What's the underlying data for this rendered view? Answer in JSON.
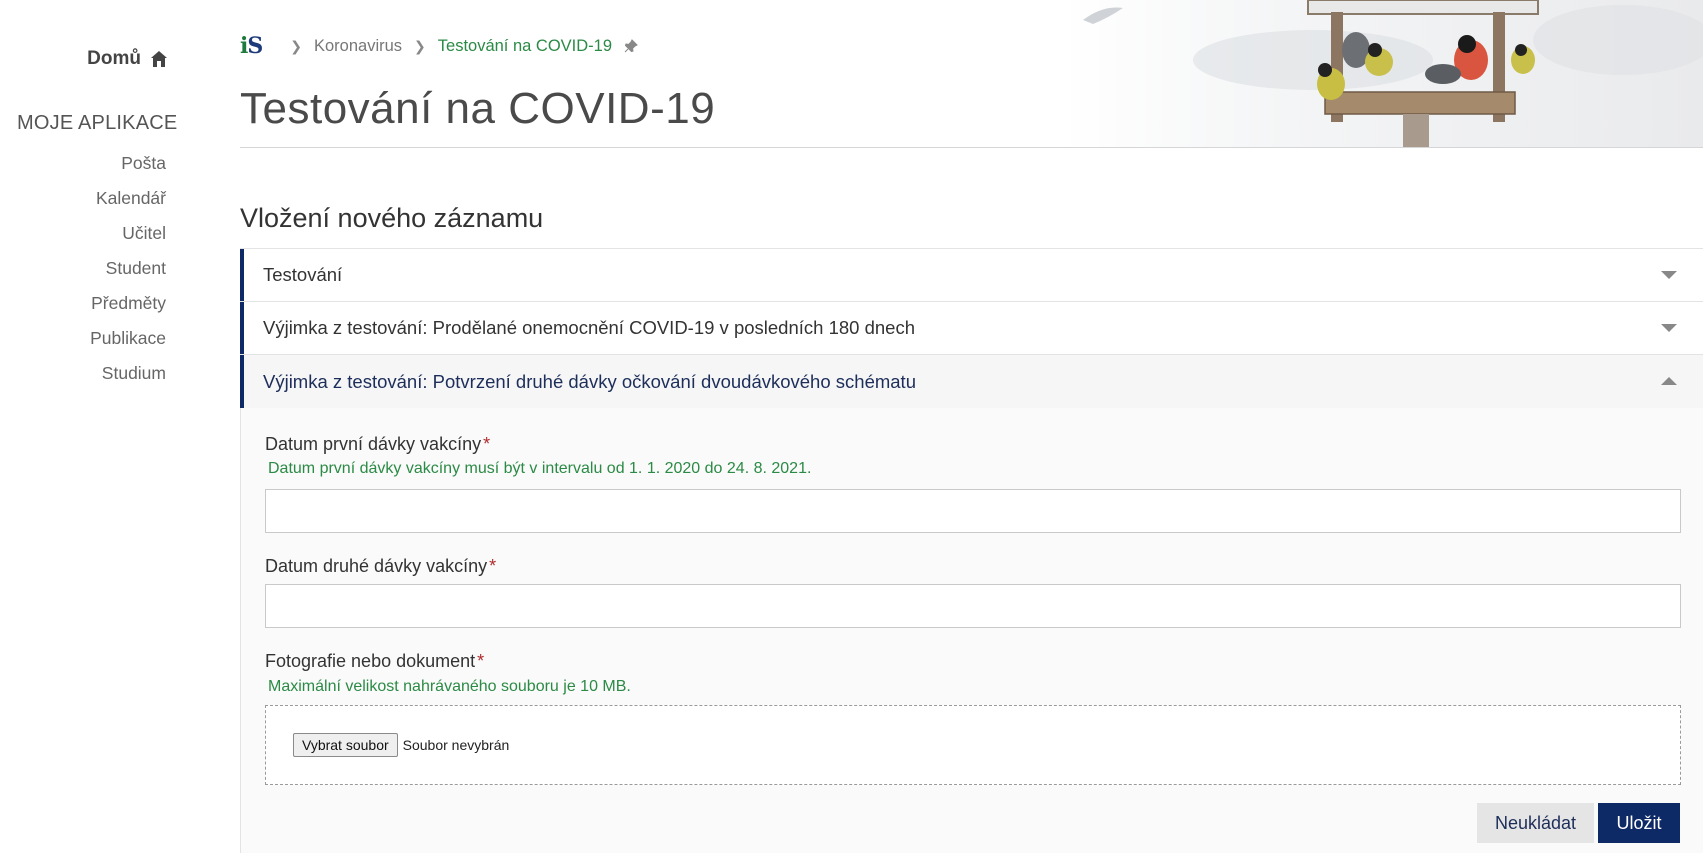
{
  "sidebar": {
    "home_label": "Domů",
    "apps_heading": "MOJE APLIKACE",
    "items": [
      {
        "label": "Pošta"
      },
      {
        "label": "Kalendář"
      },
      {
        "label": "Učitel"
      },
      {
        "label": "Student"
      },
      {
        "label": "Předměty"
      },
      {
        "label": "Publikace"
      },
      {
        "label": "Studium"
      }
    ]
  },
  "header": {
    "logo_i": "i",
    "logo_s": "S",
    "breadcrumb": [
      "Koronavirus",
      "Testování na COVID-19"
    ],
    "title": "Testování na COVID-19"
  },
  "main": {
    "section_title": "Vložení nového záznamu",
    "accordion": [
      {
        "label": "Testování",
        "open": false
      },
      {
        "label": "Výjimka z testování: Prodělané onemocnění COVID-19 v posledních 180 dnech",
        "open": false
      },
      {
        "label": "Výjimka z testování: Potvrzení druhé dávky očkování dvoudávkového schématu",
        "open": true
      }
    ],
    "form": {
      "first_dose_label": "Datum první dávky vakcíny",
      "required_mark": "*",
      "first_dose_hint": "Datum první dávky vakcíny musí být v intervalu od 1. 1. 2020 do 24. 8. 2021.",
      "first_dose_value": "",
      "second_dose_label": "Datum druhé dávky vakcíny",
      "second_dose_value": "",
      "file_label": "Fotografie nebo dokument",
      "file_hint": "Maximální velikost nahrávaného souboru je 10 MB.",
      "file_button": "Vybrat soubor",
      "file_status": "Soubor nevybrán",
      "cancel_label": "Neukládat",
      "save_label": "Uložit"
    }
  },
  "colors": {
    "accent_navy": "#0e2a66",
    "accent_green": "#2b8a45",
    "required_red": "#b02a2a"
  }
}
